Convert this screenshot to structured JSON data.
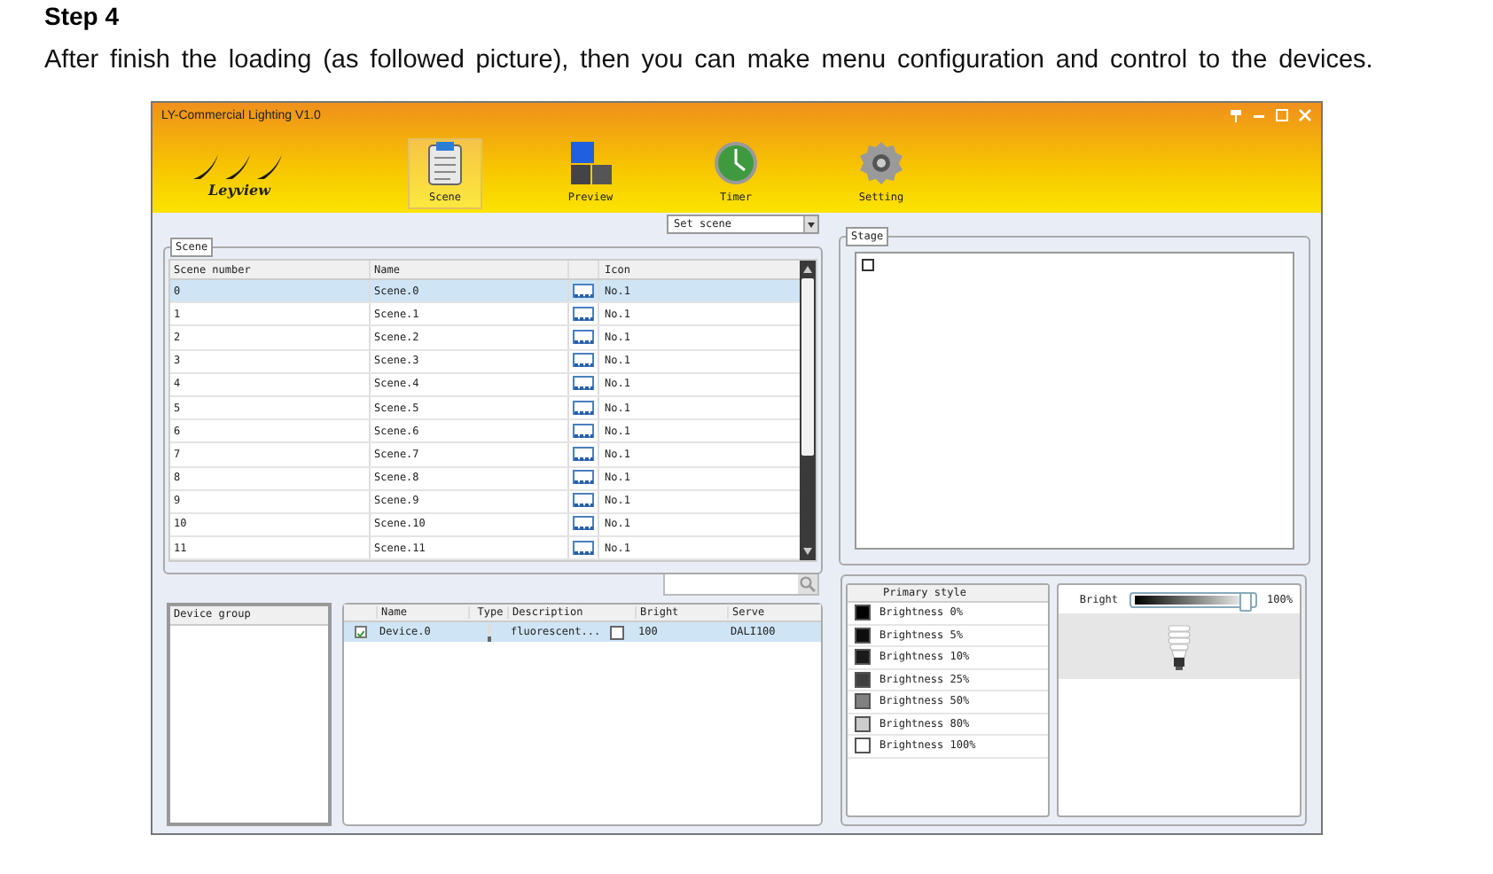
{
  "heading": "Step 4",
  "intro": "After finish the loading (as followed picture), then you can make menu configuration and control to the devices.",
  "window": {
    "title": "LY-Commercial Lighting V1.0",
    "logo_text": "Leyview"
  },
  "toolbar": [
    {
      "label": "Scene",
      "kind": "clipboard",
      "selected": true
    },
    {
      "label": "Preview",
      "kind": "blocks",
      "selected": false
    },
    {
      "label": "Timer",
      "kind": "clock",
      "selected": false
    },
    {
      "label": "Setting",
      "kind": "gear",
      "selected": false
    }
  ],
  "scene_select": {
    "value": "Set scene"
  },
  "scene_panel": {
    "title": "Scene",
    "columns": [
      "Scene number",
      "Name",
      "Icon"
    ],
    "rows": [
      {
        "number": "0",
        "name": "Scene.0",
        "icon_label": "No.1",
        "selected": true
      },
      {
        "number": "1",
        "name": "Scene.1",
        "icon_label": "No.1",
        "selected": false
      },
      {
        "number": "2",
        "name": "Scene.2",
        "icon_label": "No.1",
        "selected": false
      },
      {
        "number": "3",
        "name": "Scene.3",
        "icon_label": "No.1",
        "selected": false
      },
      {
        "number": "4",
        "name": "Scene.4",
        "icon_label": "No.1",
        "selected": false
      },
      {
        "number": "5",
        "name": "Scene.5",
        "icon_label": "No.1",
        "selected": false
      },
      {
        "number": "6",
        "name": "Scene.6",
        "icon_label": "No.1",
        "selected": false
      },
      {
        "number": "7",
        "name": "Scene.7",
        "icon_label": "No.1",
        "selected": false
      },
      {
        "number": "8",
        "name": "Scene.8",
        "icon_label": "No.1",
        "selected": false
      },
      {
        "number": "9",
        "name": "Scene.9",
        "icon_label": "No.1",
        "selected": false
      },
      {
        "number": "10",
        "name": "Scene.10",
        "icon_label": "No.1",
        "selected": false
      },
      {
        "number": "11",
        "name": "Scene.11",
        "icon_label": "No.1",
        "selected": false
      }
    ]
  },
  "stage": {
    "title": "Stage"
  },
  "device_group": {
    "title": "Device group"
  },
  "device_table": {
    "columns": [
      "Name",
      "Type",
      "Description",
      "Bright",
      "Serve"
    ],
    "rows": [
      {
        "checked": true,
        "name": "Device.0",
        "description": "fluorescent...",
        "marked": false,
        "bright": "100",
        "serve": "DALI100",
        "selected": true
      }
    ]
  },
  "primary_style": {
    "title": "Primary style",
    "items": [
      {
        "label": "Brightness 0%",
        "color": "#000000"
      },
      {
        "label": "Brightness 5%",
        "color": "#0d0d0d"
      },
      {
        "label": "Brightness 10%",
        "color": "#1a1a1a"
      },
      {
        "label": "Brightness 25%",
        "color": "#404040"
      },
      {
        "label": "Brightness 50%",
        "color": "#808080"
      },
      {
        "label": "Brightness 80%",
        "color": "#cccccc"
      },
      {
        "label": "Brightness 100%",
        "color": "#ffffff"
      }
    ]
  },
  "bright": {
    "label": "Bright",
    "level": 1,
    "reading": "100%"
  }
}
